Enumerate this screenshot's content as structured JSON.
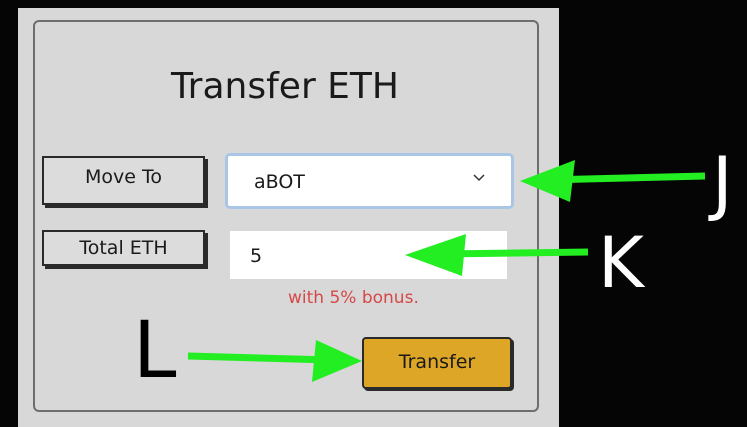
{
  "dialog": {
    "title": "Transfer ETH",
    "move_to_label": "Move To",
    "move_to_value": "aBOT",
    "total_eth_label": "Total ETH",
    "total_eth_value": "5",
    "bonus_note": "with 5% bonus.",
    "transfer_label": "Transfer"
  },
  "markers": {
    "j": "J",
    "k": "K",
    "l": "L"
  },
  "colors": {
    "panel": "#d8d8d8",
    "transfer_button": "#dea626",
    "bonus_text": "#d64848",
    "arrow": "#22ee22",
    "focus_border": "#a9c6e6"
  },
  "icons": {
    "dropdown": "chevron-down-icon",
    "arrow": "arrow-left-icon"
  }
}
